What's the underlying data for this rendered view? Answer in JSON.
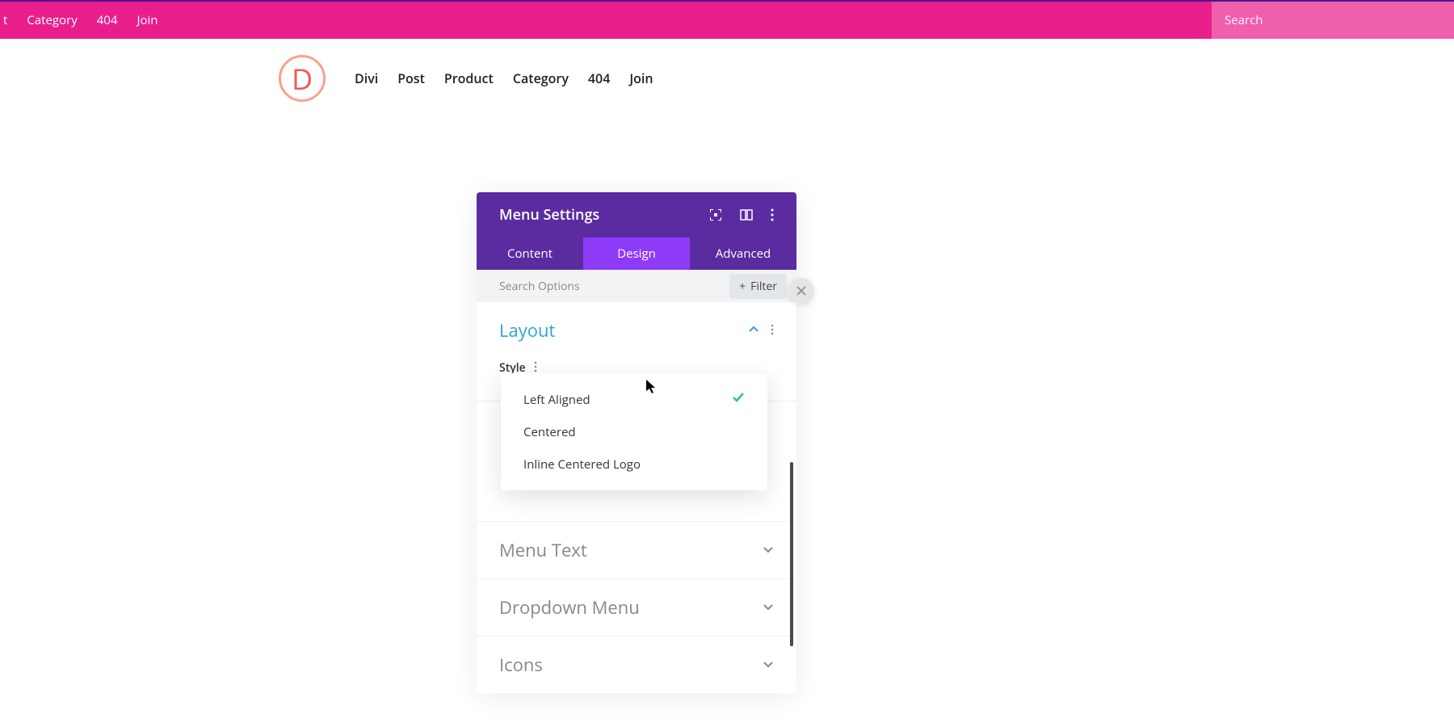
{
  "topbar": {
    "items": [
      "t",
      "Category",
      "404",
      "Join"
    ],
    "search_placeholder": "Search"
  },
  "mainnav": {
    "logo": "D",
    "links": [
      "Divi",
      "Post",
      "Product",
      "Category",
      "404",
      "Join"
    ]
  },
  "modal": {
    "title": "Menu Settings",
    "tabs": [
      "Content",
      "Design",
      "Advanced"
    ],
    "active_tab": "Design",
    "search_placeholder": "Search Options",
    "filter_label": "Filter",
    "sections": {
      "layout": {
        "title": "Layout",
        "style_label": "Style",
        "options": [
          "Left Aligned",
          "Centered",
          "Inline Centered Logo"
        ],
        "selected": "Left Aligned"
      },
      "menu_text": "Menu Text",
      "dropdown_menu": "Dropdown Menu",
      "icons": "Icons"
    }
  }
}
